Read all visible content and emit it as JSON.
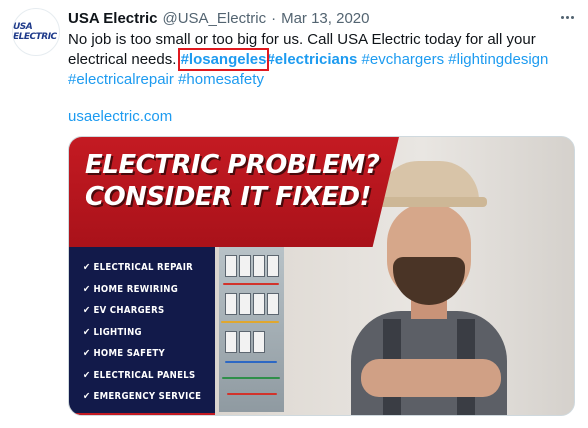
{
  "tweet": {
    "author_name": "USA Electric",
    "handle": "@USA_Electric",
    "separator": "·",
    "date": "Mar 13, 2020",
    "avatar_text": "USA ELECTRIC",
    "text_main": "No job is too small or too big for us. Call USA Electric today for all your electrical needs.",
    "hashtags": [
      "#losangeles",
      "#electricians",
      "#evchargers",
      "#lightingdesign",
      "#electricalrepair",
      "#homesafety"
    ],
    "link": "usaelectric.com"
  },
  "promo_image": {
    "headline_line1": "ELECTRIC PROBLEM?",
    "headline_line2": "CONSIDER IT FIXED!",
    "check_glyph": "✔",
    "services": [
      "ELECTRICAL REPAIR",
      "HOME REWIRING",
      "EV CHARGERS",
      "LIGHTING",
      "HOME SAFETY",
      "ELECTRICAL PANELS",
      "EMERGENCY SERVICE"
    ]
  },
  "colors": {
    "accent_link": "#1d9bf0",
    "highlight_box": "#e0191f",
    "brand_red": "#c41a22",
    "brand_navy": "#121a4a"
  },
  "icons": [
    "more-options-icon",
    "check-icon"
  ]
}
